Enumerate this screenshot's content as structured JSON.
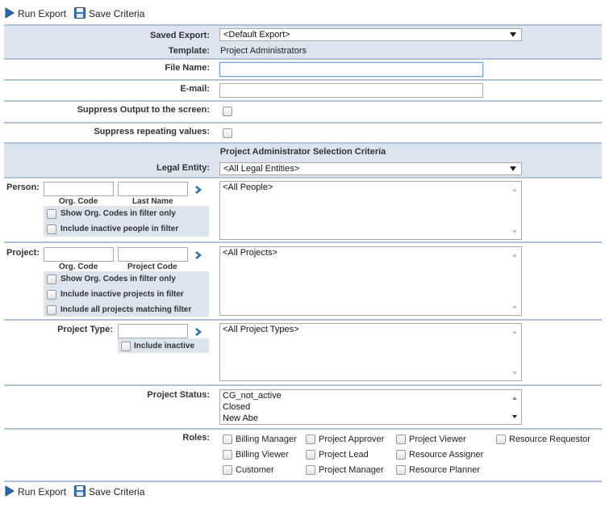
{
  "toolbar": {
    "run_export": "Run Export",
    "save_criteria": "Save Criteria"
  },
  "saved_export": {
    "label": "Saved Export:",
    "value": "<Default Export>"
  },
  "template": {
    "label": "Template:",
    "value": "Project Administrators"
  },
  "file_name": {
    "label": "File Name:",
    "value": ""
  },
  "email": {
    "label": "E-mail:",
    "value": ""
  },
  "suppress_output": {
    "label": "Suppress Output to the screen:"
  },
  "suppress_repeating": {
    "label": "Suppress repeating values:"
  },
  "section_title": "Project Administrator Selection Criteria",
  "legal_entity": {
    "label": "Legal Entity:",
    "value": "<All Legal Entities>"
  },
  "person": {
    "label": "Person:",
    "org_code_label": "Org. Code",
    "last_name_label": "Last Name",
    "show_org_codes": "Show Org. Codes in filter only",
    "include_inactive": "Include inactive people in filter",
    "list": [
      "<All People>"
    ]
  },
  "project": {
    "label": "Project:",
    "org_code_label": "Org. Code",
    "project_code_label": "Project Code",
    "show_org_codes": "Show Org. Codes in filter only",
    "include_inactive": "Include inactive projects in filter",
    "include_all_matching": "Include all projects matching filter",
    "list": [
      "<All Projects>"
    ]
  },
  "project_type": {
    "label": "Project Type:",
    "include_inactive": "Include inactive",
    "list": [
      "<All Project Types>"
    ]
  },
  "project_status": {
    "label": "Project Status:",
    "list": [
      "CG_not_active",
      "Closed",
      "New Abe"
    ]
  },
  "roles": {
    "label": "Roles:",
    "items": [
      "Billing Manager",
      "Project Approver",
      "Project Viewer",
      "Resource Requestor",
      "Billing Viewer",
      "Project Lead",
      "Resource Assigner",
      "Customer",
      "Project Manager",
      "Resource Planner"
    ]
  },
  "colors": {
    "accent": "#2a6db8",
    "band": "#dce4ee",
    "separator": "#b3c3d7"
  }
}
